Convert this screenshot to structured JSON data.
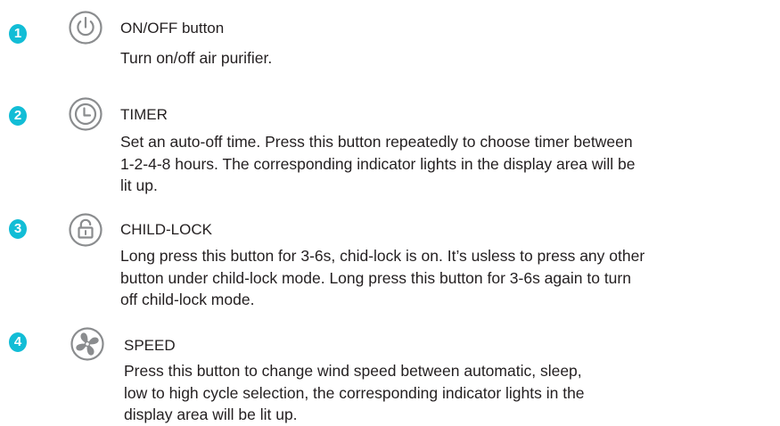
{
  "accent_color": "#12bdd6",
  "text_color": "#231f20",
  "icon_color": "#8a8c8e",
  "items": [
    {
      "number": "1",
      "icon": "power-icon",
      "title": "ON/OFF button",
      "lines": [
        "Turn on/off air purifier."
      ]
    },
    {
      "number": "2",
      "icon": "clock-icon",
      "title": "TIMER",
      "lines": [
        "Set an auto-off time. Press this button repeatedly to choose timer between",
        "1-2-4-8 hours. The corresponding indicator lights in the display area will be",
        "lit up."
      ]
    },
    {
      "number": "3",
      "icon": "unlock-icon",
      "title": "CHILD-LOCK",
      "lines": [
        "Long press this button for 3-6s, chid-lock is on. It’s usless to press any other",
        "button under child-lock mode. Long press this button for 3-6s again to turn",
        "off child-lock mode."
      ]
    },
    {
      "number": "4",
      "icon": "fan-icon",
      "title": "SPEED",
      "lines": [
        "Press this button to change wind speed between automatic, sleep,",
        "low to high cycle selection, the corresponding indicator lights in the",
        "display area will be lit up."
      ]
    }
  ]
}
